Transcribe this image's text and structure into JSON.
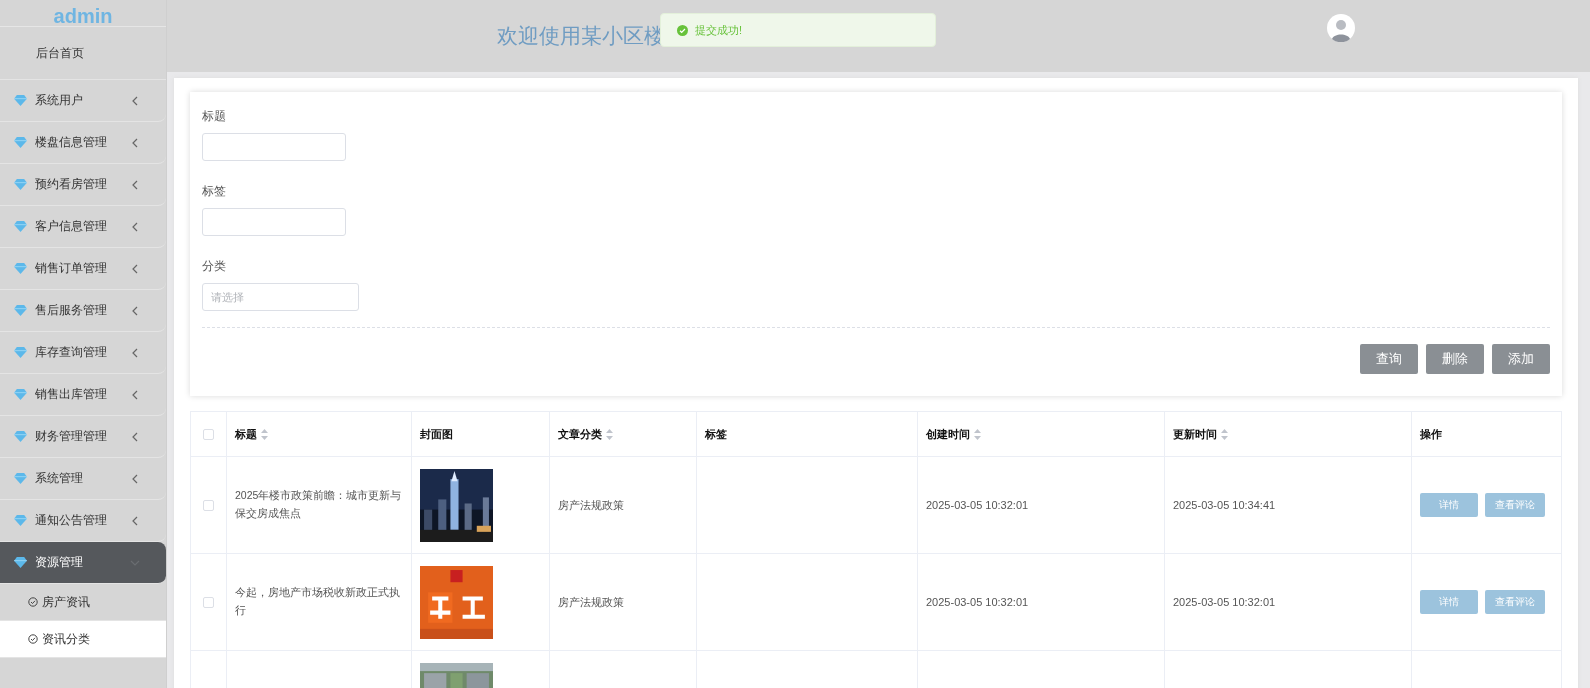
{
  "sidebar": {
    "brand": "admin",
    "home": "后台首页",
    "items": [
      {
        "label": "系统用户",
        "expanded": false,
        "selected": false
      },
      {
        "label": "楼盘信息管理",
        "expanded": false,
        "selected": false
      },
      {
        "label": "预约看房管理",
        "expanded": false,
        "selected": false
      },
      {
        "label": "客户信息管理",
        "expanded": false,
        "selected": false
      },
      {
        "label": "销售订单管理",
        "expanded": false,
        "selected": false
      },
      {
        "label": "售后服务管理",
        "expanded": false,
        "selected": false
      },
      {
        "label": "库存查询管理",
        "expanded": false,
        "selected": false
      },
      {
        "label": "销售出库管理",
        "expanded": false,
        "selected": false
      },
      {
        "label": "财务管理管理",
        "expanded": false,
        "selected": false
      },
      {
        "label": "系统管理",
        "expanded": false,
        "selected": false
      },
      {
        "label": "通知公告管理",
        "expanded": false,
        "selected": false
      },
      {
        "label": "资源管理",
        "expanded": true,
        "selected": true,
        "children": [
          {
            "label": "房产资讯",
            "selected": false
          },
          {
            "label": "资讯分类",
            "selected": true
          }
        ]
      }
    ]
  },
  "header": {
    "title": "欢迎使用某小区楼",
    "toast": "提交成功!"
  },
  "search": {
    "fields": [
      {
        "label": "标题",
        "kind": "text"
      },
      {
        "label": "标签",
        "kind": "text"
      },
      {
        "label": "分类",
        "kind": "select",
        "placeholder": "请选择"
      }
    ],
    "buttons": [
      "查询",
      "删除",
      "添加"
    ]
  },
  "table": {
    "all_checked": false,
    "columns": [
      {
        "label": "标题",
        "sortable": true
      },
      {
        "label": "封面图",
        "sortable": false
      },
      {
        "label": "文章分类",
        "sortable": true
      },
      {
        "label": "标签",
        "sortable": false
      },
      {
        "label": "创建时间",
        "sortable": true
      },
      {
        "label": "更新时间",
        "sortable": true
      },
      {
        "label": "操作",
        "sortable": false
      }
    ],
    "rows": [
      {
        "checked": false,
        "title": "2025年楼市政策前瞻：城市更新与保交房成焦点",
        "cover": {
          "kind": "picture"
        },
        "category": "房产法规政策",
        "created": "2025-03-05 10:32:01",
        "updated": "2025-03-05 10:34:41",
        "actions": [
          "详情",
          "查看评论"
        ]
      },
      {
        "checked": false,
        "title": "今起，房地产市场税收新政正式执行",
        "cover": {
          "kind": "picture"
        },
        "category": "房产法规政策",
        "created": "2025-03-05 10:32:01",
        "updated": "2025-03-05 10:32:01",
        "actions": [
          "详情",
          "查看评论"
        ]
      },
      {
        "cover": {
          "kind": "picture"
        }
      }
    ]
  }
}
